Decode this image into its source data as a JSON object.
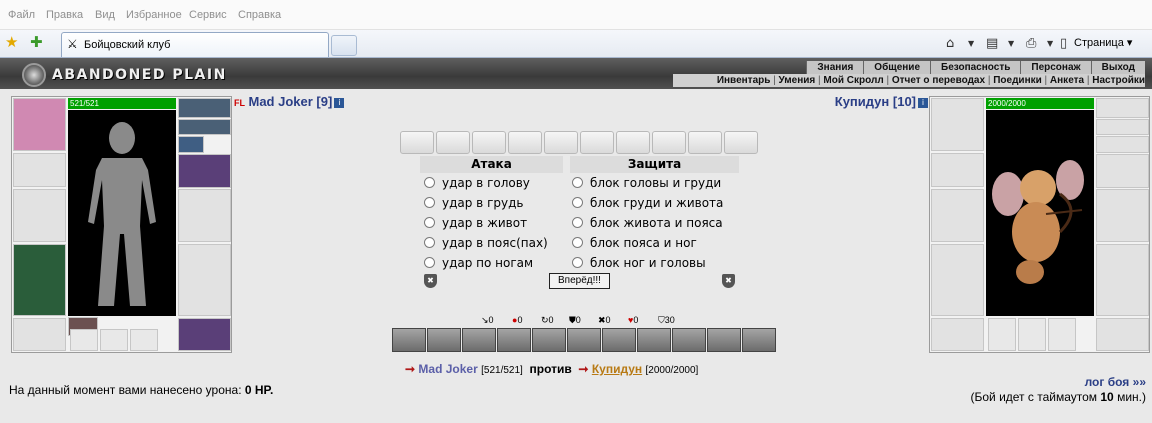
{
  "browser": {
    "menu": [
      "Файл",
      "Правка",
      "Вид",
      "Избранное",
      "Сервис",
      "Справка"
    ],
    "tab_title": "Бойцовский клуб",
    "page_menu": "Страница"
  },
  "game": {
    "logo": "ABANDONED PLAIN",
    "top_nav": [
      "Знания",
      "Общение",
      "Безопасность",
      "Персонаж",
      "Выход"
    ],
    "sub_nav": [
      "Инвентарь",
      "Умения",
      "Мой Скролл",
      "Отчет о переводах",
      "Поединки",
      "Анкета",
      "Настройки"
    ]
  },
  "player": {
    "badge": "FL",
    "name": "Mad Joker [9]",
    "hp": "521/521",
    "hp_fraction": 1.0
  },
  "enemy": {
    "name": "Купидун [10]",
    "hp": "2000/2000",
    "hp_fraction": 1.0
  },
  "attack": {
    "title": "Атака",
    "options": [
      "удар в голову",
      "удар в грудь",
      "удар в живот",
      "удар в пояс(пах)",
      "удар по ногам"
    ]
  },
  "defense": {
    "title": "Защита",
    "options": [
      "блок головы и груди",
      "блок груди и живота",
      "блок живота и пояса",
      "блок пояса и ног",
      "блок ног и головы"
    ]
  },
  "go_button": "Вперёд!!!",
  "stats": [
    {
      "icon": "sword-icon",
      "glyph": "↘",
      "value": "0"
    },
    {
      "icon": "blood-icon",
      "glyph": "●",
      "value": "0"
    },
    {
      "icon": "counter-icon",
      "glyph": "↻",
      "value": "0"
    },
    {
      "icon": "block-icon",
      "glyph": "⛊",
      "value": "0"
    },
    {
      "icon": "crossed-swords-icon",
      "glyph": "✖",
      "value": "0"
    },
    {
      "icon": "heart-icon",
      "glyph": "♥",
      "value": "0"
    },
    {
      "icon": "shield-icon",
      "glyph": "⛉",
      "value": "30"
    }
  ],
  "versus": {
    "player_name": "Mad Joker",
    "player_hp": "[521/521]",
    "word": "против",
    "enemy_name": "Купидун",
    "enemy_hp": "[2000/2000]"
  },
  "damage": {
    "prefix": "На данный момент вами нанесено урона:",
    "value": "0 HP."
  },
  "log": {
    "link": "лог боя »»",
    "timeout_prefix": "(Бой идет с таймаутом",
    "timeout_value": "10",
    "timeout_suffix": "мин.)"
  }
}
